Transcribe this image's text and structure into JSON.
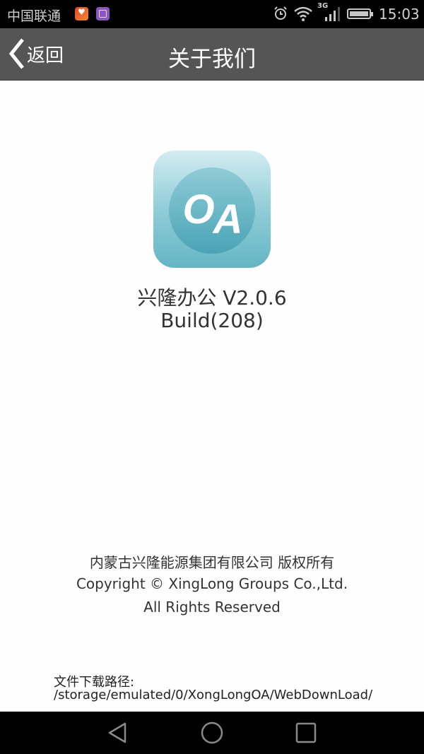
{
  "status_bar": {
    "carrier": "中国联通",
    "network_type": "3G",
    "time": "15:03",
    "icons": [
      "health-app-icon",
      "gallery-app-icon",
      "alarm-icon",
      "wifi-icon",
      "signal-icon",
      "battery-icon"
    ]
  },
  "nav_bar": {
    "back_label": "返回",
    "title": "关于我们"
  },
  "app_info": {
    "icon_text_o": "O",
    "icon_text_a": "A",
    "name_version": "兴隆办公 V2.0.6",
    "build": "Build(208)"
  },
  "copyright": {
    "line1": "内蒙古兴隆能源集团有限公司 版权所有",
    "line2": "Copyright © XingLong Groups Co.,Ltd.",
    "line3": "All Rights Reserved"
  },
  "download": {
    "label": "文件下载路径:",
    "path": "/storage/emulated/0/XongLongOA/WebDownLoad/"
  },
  "system_nav": {
    "buttons": [
      "back",
      "home",
      "recents"
    ]
  },
  "colors": {
    "nav_bar_bg": "#555555",
    "status_bar_bg": "#000000",
    "icon_teal": "#64b5c4"
  }
}
